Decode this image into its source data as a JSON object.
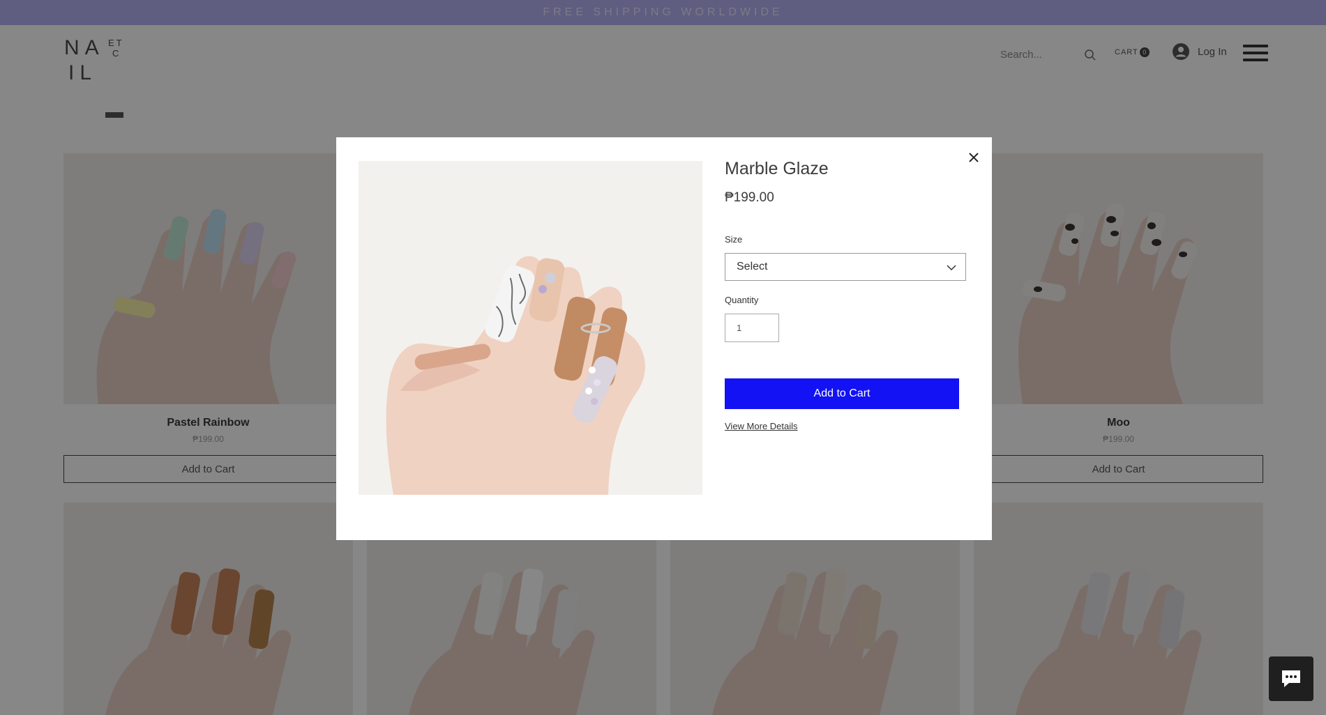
{
  "banner": {
    "text": "FREE SHIPPING WORLDWIDE"
  },
  "header": {
    "logo": {
      "line1": "NA",
      "line2": "IL",
      "small1": "ET",
      "small2": "C"
    },
    "search_placeholder": "Search...",
    "cart_label": "CART",
    "cart_count": "0",
    "login_label": "Log In"
  },
  "products": [
    {
      "name": "Pastel Rainbow",
      "price": "₱199.00",
      "button": "Add to Cart"
    },
    {
      "name": "Moo",
      "price": "₱199.00",
      "button": "Add to Cart"
    }
  ],
  "modal": {
    "title": "Marble Glaze",
    "price": "₱199.00",
    "size_label": "Size",
    "size_value": "Select",
    "quantity_label": "Quantity",
    "quantity_value": "1",
    "add_to_cart": "Add to Cart",
    "view_details": "View More Details"
  },
  "colors": {
    "banner": "#b4b2f2",
    "add_to_cart_button": "#1212f5",
    "overlay": "rgba(0,0,0,0.47)"
  }
}
